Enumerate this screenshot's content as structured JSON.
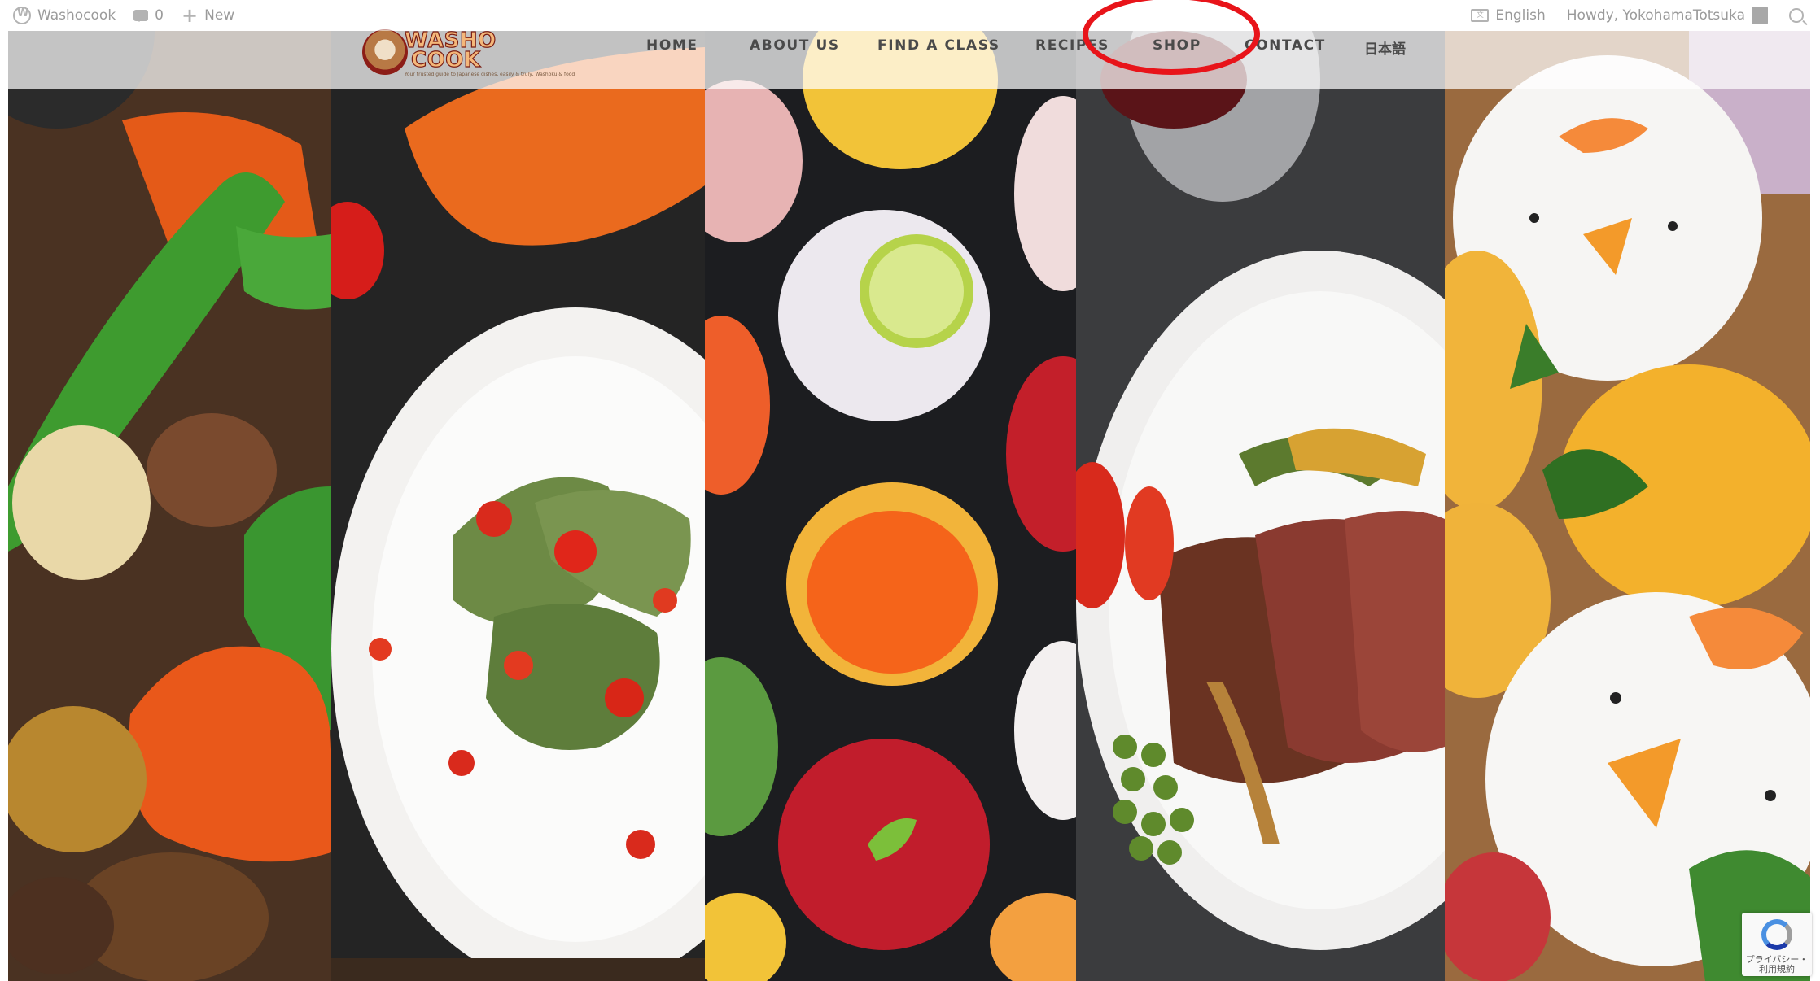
{
  "admin_bar": {
    "site_name": "Washocook",
    "comment_count": "0",
    "new_label": "New",
    "language": "English",
    "greeting": "Howdy, YokohamaTotsuka"
  },
  "header": {
    "logo_line1": "WASHO",
    "logo_line2": "COOK",
    "logo_tagline": "Your trusted guide to Japanese dishes, easily & truly, Washoku & food"
  },
  "nav": {
    "items": [
      {
        "label": "HOME"
      },
      {
        "label": "ABOUT US"
      },
      {
        "label": "FIND A CLASS"
      },
      {
        "label": "RECIPES"
      },
      {
        "label": "SHOP"
      },
      {
        "label": "CONTACT"
      },
      {
        "label": "日本語"
      }
    ]
  },
  "hero": {
    "panels": [
      {
        "name": "nikujaga",
        "accent": "#e8581c"
      },
      {
        "name": "ravioli",
        "accent": "#2f7a3a"
      },
      {
        "name": "temari-sushi",
        "accent": "#f4822a"
      },
      {
        "name": "roast-beef",
        "accent": "#7a2e22"
      },
      {
        "name": "chick-rice-balls",
        "accent": "#f2a62a"
      }
    ]
  },
  "recaptcha": {
    "text": "プライバシー・利用規約"
  },
  "colors": {
    "annotation": "#e8141a",
    "nav_text": "#4a4a4a"
  }
}
